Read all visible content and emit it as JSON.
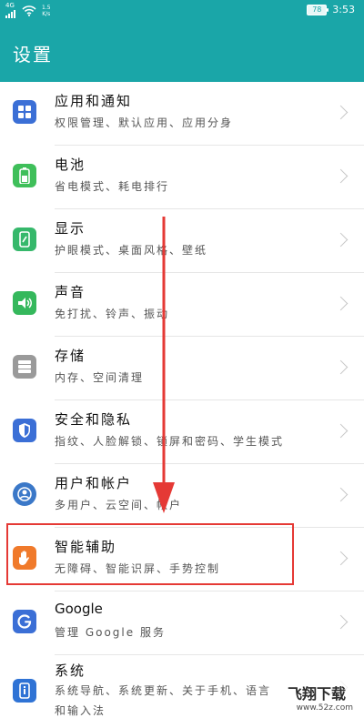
{
  "status_bar": {
    "network": "4G",
    "speed_top": "1.5",
    "speed_unit": "K/s",
    "battery": "78",
    "time": "3:53"
  },
  "header": {
    "title": "设置"
  },
  "colors": {
    "accent": "#1aa6a8",
    "apps": "#3b6fd6",
    "battery": "#3fbf5a",
    "display": "#36b86b",
    "sound": "#35b85c",
    "storage": "#9a9a9a",
    "security": "#3b6fd6",
    "users": "#3b78c8",
    "assist": "#f07a2b",
    "google": "#3b6fd6",
    "system": "#2f73d5",
    "highlight": "#e53935"
  },
  "items": [
    {
      "title": "应用和通知",
      "subtitle": "权限管理、默认应用、应用分身",
      "icon": "apps-grid-icon"
    },
    {
      "title": "电池",
      "subtitle": "省电模式、耗电排行",
      "icon": "battery-icon"
    },
    {
      "title": "显示",
      "subtitle": "护眼模式、桌面风格、壁纸",
      "icon": "display-icon"
    },
    {
      "title": "声音",
      "subtitle": "免打扰、铃声、振动",
      "icon": "speaker-icon"
    },
    {
      "title": "存储",
      "subtitle": "内存、空间清理",
      "icon": "storage-icon"
    },
    {
      "title": "安全和隐私",
      "subtitle": "指纹、人脸解锁、锁屏和密码、学生模式",
      "icon": "shield-icon"
    },
    {
      "title": "用户和帐户",
      "subtitle": "多用户、云空间、帐户",
      "icon": "user-icon"
    },
    {
      "title": "智能辅助",
      "subtitle": "无障碍、智能识屏、手势控制",
      "icon": "hand-icon"
    },
    {
      "title": "Google",
      "subtitle": "管理 Google 服务",
      "icon": "google-icon"
    },
    {
      "title": "系统",
      "subtitle": "系统导航、系统更新、关于手机、语言",
      "subtitle2": "和输入法",
      "icon": "info-icon"
    }
  ],
  "watermark": {
    "line1": "飞翔下载",
    "line2": "www.52z.com"
  }
}
